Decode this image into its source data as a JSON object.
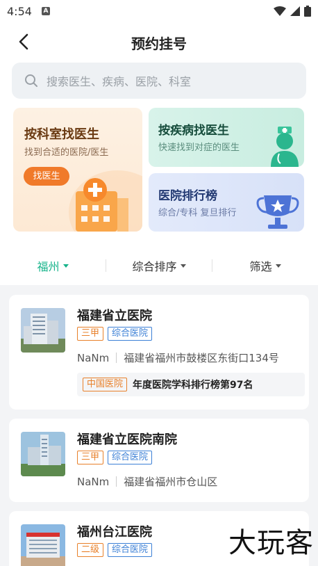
{
  "status": {
    "time": "4:54",
    "badge": "A"
  },
  "header": {
    "title": "预约挂号"
  },
  "search": {
    "placeholder": "搜索医生、疾病、医院、科室"
  },
  "cards": {
    "dept": {
      "title": "按科室找医生",
      "subtitle": "找到合适的医院/医生",
      "button": "找医生"
    },
    "disease": {
      "title": "按疾病找医生",
      "subtitle": "快速找到对症的医生"
    },
    "rank": {
      "title": "医院排行榜",
      "subtitle": "综合/专科 复旦排行"
    }
  },
  "filters": {
    "city": "福州",
    "sort": "综合排序",
    "filter": "筛选"
  },
  "hospitals": [
    {
      "name": "福建省立医院",
      "level": "三甲",
      "type": "综合医院",
      "distance": "NaNm",
      "address": "福建省福州市鼓楼区东街口134号",
      "rank_tag": "中国医院",
      "rank_text": "年度医院学科排行榜第97名"
    },
    {
      "name": "福建省立医院南院",
      "level": "三甲",
      "type": "综合医院",
      "distance": "NaNm",
      "address": "福建省福州市仓山区"
    },
    {
      "name": "福州台江医院",
      "level": "二级",
      "type": "综合医院"
    }
  ],
  "watermark": "大玩客",
  "colors": {
    "accent": "#16b38a",
    "orange": "#f07a2a",
    "blue_tag": "#3c80d6"
  }
}
